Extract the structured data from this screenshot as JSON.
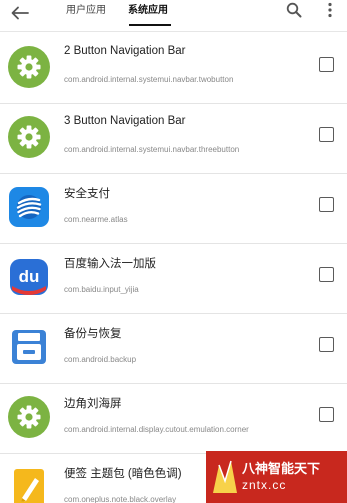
{
  "header": {
    "tabs": [
      {
        "label": "用户应用",
        "selected": false
      },
      {
        "label": "系统应用",
        "selected": true
      }
    ],
    "back_icon": "arrow-left-icon",
    "search_icon": "search-icon",
    "more_icon": "more-vert-icon"
  },
  "apps": [
    {
      "name": "2 Button Navigation Bar",
      "package": "com.android.internal.systemui.navbar.twobutton",
      "icon": "gear-icon",
      "checked": false
    },
    {
      "name": "3 Button Navigation Bar",
      "package": "com.android.internal.systemui.navbar.threebutton",
      "icon": "gear-icon",
      "checked": false
    },
    {
      "name": "安全支付",
      "package": "com.nearme.atlas",
      "icon": "secure-pay-icon",
      "checked": false
    },
    {
      "name": "百度输入法一加版",
      "package": "com.baidu.input_yijia",
      "icon": "baidu-input-icon",
      "checked": false
    },
    {
      "name": "备份与恢复",
      "package": "com.android.backup",
      "icon": "backup-icon",
      "checked": false
    },
    {
      "name": "边角刘海屏",
      "package": "com.android.internal.display.cutout.emulation.corner",
      "icon": "gear-icon",
      "checked": false
    },
    {
      "name": "便签 主题包 (暗色色调)",
      "package": "com.oneplus.note.black.overlay",
      "icon": "note-icon",
      "checked": false
    }
  ],
  "watermark": {
    "title": "八神智能天下",
    "url": "zntx.cc"
  },
  "colors": {
    "gear_green": "#7cb342",
    "secure_pay_blue": "#1e88e5",
    "baidu_blue": "#2a6fd6",
    "backup_blue": "#3b82d6",
    "note_yellow": "#f5b81c",
    "watermark_red": "#c8281e"
  }
}
